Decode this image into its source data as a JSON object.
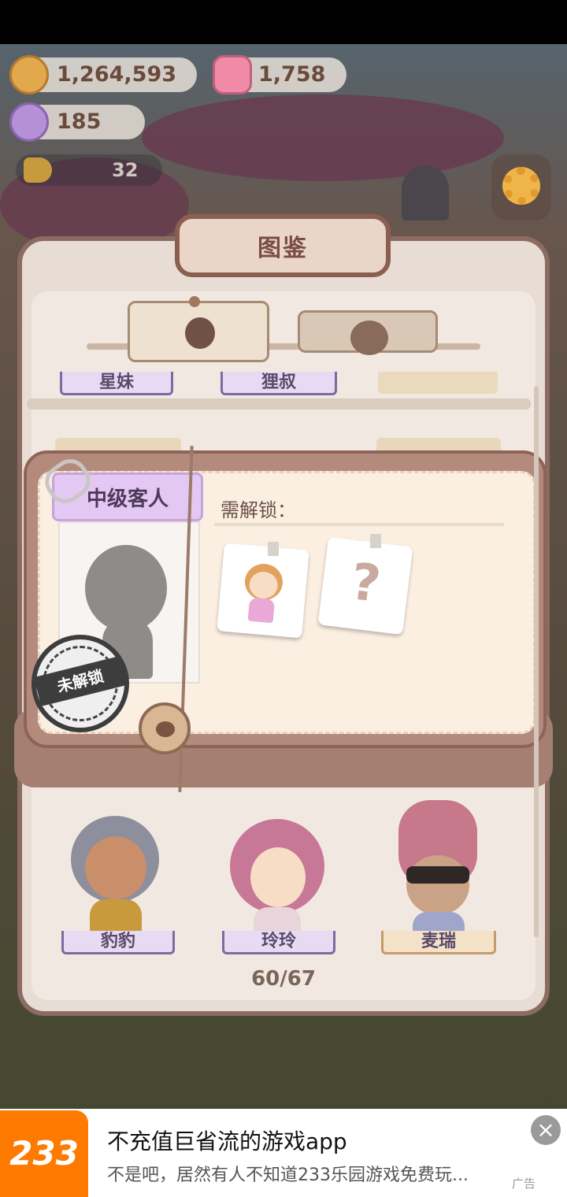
{
  "colors": {
    "accent": "#8c5e52",
    "level_tag": "#e4c8f4",
    "ad_logo": "#ff7a00"
  },
  "hud": {
    "coins": "1,264,593",
    "gems": "1,758",
    "candies": "185",
    "notice_count": "32",
    "icons": [
      "cookie-coin-icon",
      "pink-gem-icon",
      "candy-icon",
      "megaphone-icon",
      "settings-gear-icon"
    ]
  },
  "collection": {
    "title": "图鉴",
    "tabs": [
      {
        "icon": "skull-face-icon",
        "selected": true
      },
      {
        "icon": "character-face-icon",
        "selected": false
      }
    ],
    "top_row_names": [
      "星妹",
      "狸叔",
      ""
    ],
    "bottom_row_names": [
      "豹豹",
      "玲玲",
      "麦瑞"
    ],
    "progress": "60/67"
  },
  "popup": {
    "level": "中级客人",
    "requirement_label": "需解锁：",
    "stamp": "未解锁",
    "cards": [
      "customer-portrait-card",
      "unknown-question-card"
    ]
  },
  "ad": {
    "logo": "233",
    "title": "不充值巨省流的游戏app",
    "subtitle": "不是吧，居然有人不知道233乐园游戏免费玩...",
    "label": "广告",
    "close": "×"
  }
}
